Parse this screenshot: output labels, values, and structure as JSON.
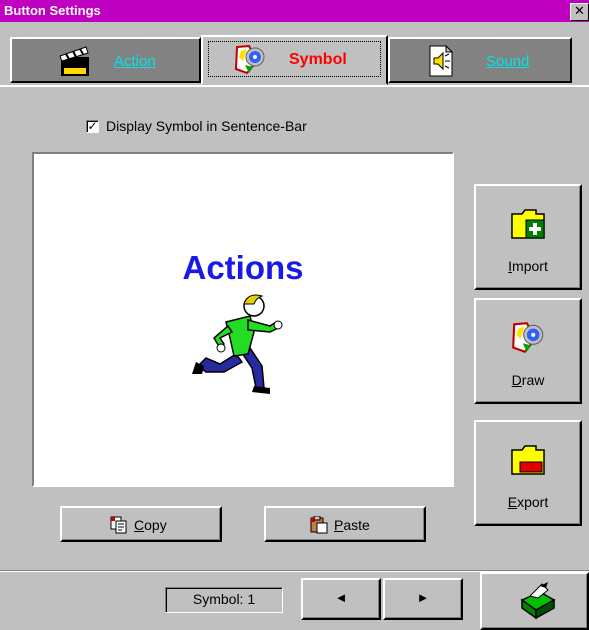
{
  "window": {
    "title": "Button Settings",
    "close_label": "✕"
  },
  "tabs": [
    {
      "label": "Action",
      "icon": "clapperboard-icon",
      "active": false
    },
    {
      "label": "Symbol",
      "icon": "symbol-draw-icon",
      "active": true
    },
    {
      "label": "Sound",
      "icon": "speaker-icon",
      "active": false
    }
  ],
  "display_symbol": {
    "label": "Display Symbol in Sentence-Bar",
    "checked": true,
    "check_mark": "✓"
  },
  "preview": {
    "caption": "Actions",
    "image": "running-man-icon"
  },
  "side_buttons": {
    "import": {
      "key": "I",
      "rest": "mport",
      "icon": "folder-add-icon"
    },
    "draw": {
      "key": "D",
      "rest": "raw",
      "icon": "symbol-draw-icon"
    },
    "export": {
      "key": "E",
      "rest": "xport",
      "icon": "folder-remove-icon"
    }
  },
  "clipboard": {
    "copy": {
      "key": "C",
      "rest": "opy",
      "icon": "copy-icon"
    },
    "paste": {
      "key": "P",
      "rest": "aste",
      "icon": "paste-icon"
    }
  },
  "status": {
    "symbol_label": "Symbol: 1"
  },
  "nav": {
    "prev": "◄",
    "next": "►"
  },
  "ok_button": {
    "icon": "cash-register-icon"
  },
  "colors": {
    "titlebar": "#c000c0",
    "active_tab_text": "#ff0000",
    "inactive_tab_text": "#00e5e5",
    "caption": "#1a1ae6"
  }
}
